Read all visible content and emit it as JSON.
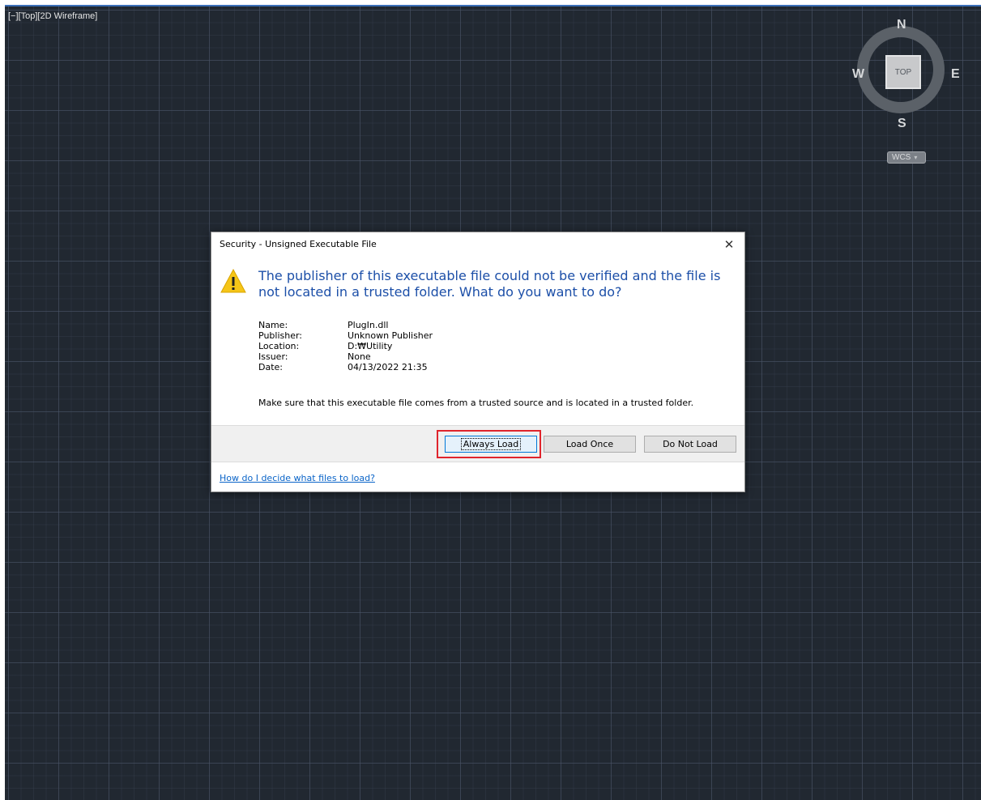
{
  "viewport": {
    "label_minus": "[−]",
    "label_view": "[Top]",
    "label_style": "[2D Wireframe]"
  },
  "viewcube": {
    "north": "N",
    "south": "S",
    "east": "E",
    "west": "W",
    "face": "TOP",
    "wcs_label": "WCS",
    "wcs_caret": "▾"
  },
  "dialog": {
    "title": "Security - Unsigned Executable File",
    "close_glyph": "✕",
    "message": "The publisher of this executable file could not be verified and the file is not located in a trusted folder. What do you want to do?",
    "details": [
      {
        "key": "Name:",
        "value": "PlugIn.dll"
      },
      {
        "key": "Publisher:",
        "value": "Unknown Publisher"
      },
      {
        "key": "Location:",
        "value": "D:₩Utility"
      },
      {
        "key": "Issuer:",
        "value": "None"
      },
      {
        "key": "Date:",
        "value": "04/13/2022  21:35"
      }
    ],
    "trust_note": "Make sure that this executable file comes from a trusted source and is located in a trusted folder.",
    "buttons": {
      "always_load": "Always Load",
      "load_once": "Load Once",
      "do_not_load": "Do Not Load"
    },
    "help_link": "How do I decide what files to load?"
  },
  "colors": {
    "message_blue": "#1c4fa8",
    "highlight_red": "#e0242c",
    "viewport_bg": "#212831"
  }
}
